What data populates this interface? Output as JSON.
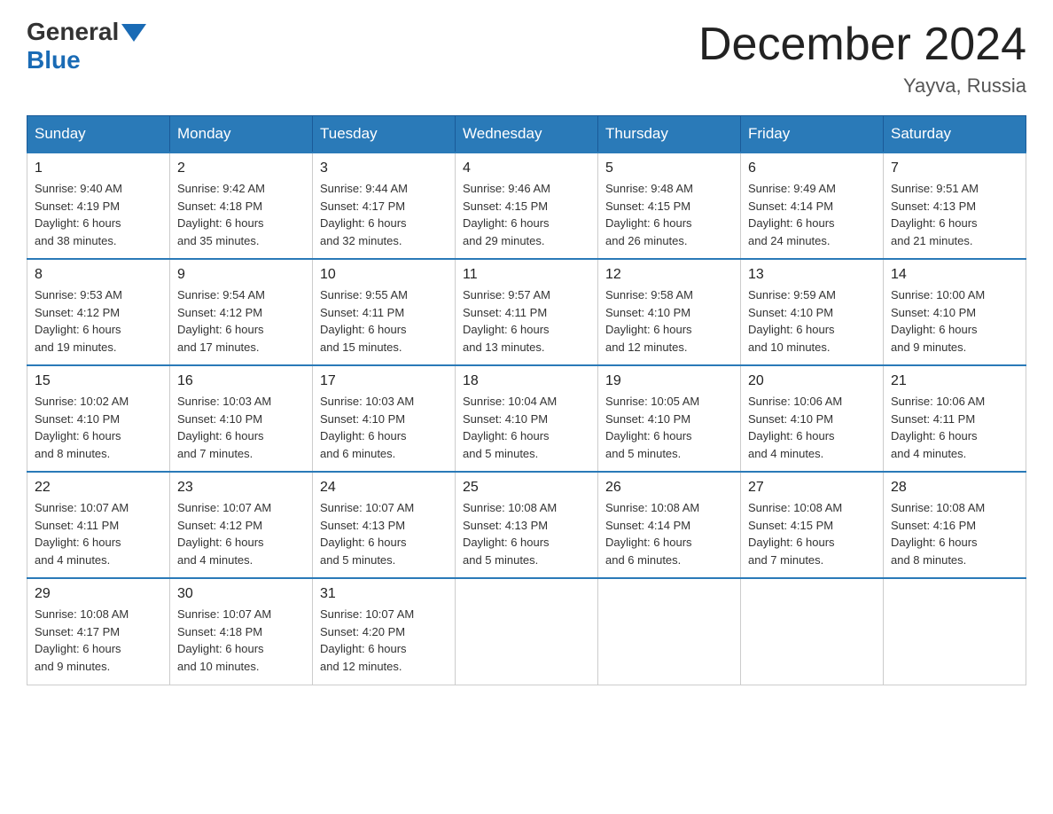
{
  "logo": {
    "text_general": "General",
    "text_blue": "Blue"
  },
  "title": "December 2024",
  "location": "Yayva, Russia",
  "days_of_week": [
    "Sunday",
    "Monday",
    "Tuesday",
    "Wednesday",
    "Thursday",
    "Friday",
    "Saturday"
  ],
  "weeks": [
    [
      {
        "day": "1",
        "info": "Sunrise: 9:40 AM\nSunset: 4:19 PM\nDaylight: 6 hours\nand 38 minutes."
      },
      {
        "day": "2",
        "info": "Sunrise: 9:42 AM\nSunset: 4:18 PM\nDaylight: 6 hours\nand 35 minutes."
      },
      {
        "day": "3",
        "info": "Sunrise: 9:44 AM\nSunset: 4:17 PM\nDaylight: 6 hours\nand 32 minutes."
      },
      {
        "day": "4",
        "info": "Sunrise: 9:46 AM\nSunset: 4:15 PM\nDaylight: 6 hours\nand 29 minutes."
      },
      {
        "day": "5",
        "info": "Sunrise: 9:48 AM\nSunset: 4:15 PM\nDaylight: 6 hours\nand 26 minutes."
      },
      {
        "day": "6",
        "info": "Sunrise: 9:49 AM\nSunset: 4:14 PM\nDaylight: 6 hours\nand 24 minutes."
      },
      {
        "day": "7",
        "info": "Sunrise: 9:51 AM\nSunset: 4:13 PM\nDaylight: 6 hours\nand 21 minutes."
      }
    ],
    [
      {
        "day": "8",
        "info": "Sunrise: 9:53 AM\nSunset: 4:12 PM\nDaylight: 6 hours\nand 19 minutes."
      },
      {
        "day": "9",
        "info": "Sunrise: 9:54 AM\nSunset: 4:12 PM\nDaylight: 6 hours\nand 17 minutes."
      },
      {
        "day": "10",
        "info": "Sunrise: 9:55 AM\nSunset: 4:11 PM\nDaylight: 6 hours\nand 15 minutes."
      },
      {
        "day": "11",
        "info": "Sunrise: 9:57 AM\nSunset: 4:11 PM\nDaylight: 6 hours\nand 13 minutes."
      },
      {
        "day": "12",
        "info": "Sunrise: 9:58 AM\nSunset: 4:10 PM\nDaylight: 6 hours\nand 12 minutes."
      },
      {
        "day": "13",
        "info": "Sunrise: 9:59 AM\nSunset: 4:10 PM\nDaylight: 6 hours\nand 10 minutes."
      },
      {
        "day": "14",
        "info": "Sunrise: 10:00 AM\nSunset: 4:10 PM\nDaylight: 6 hours\nand 9 minutes."
      }
    ],
    [
      {
        "day": "15",
        "info": "Sunrise: 10:02 AM\nSunset: 4:10 PM\nDaylight: 6 hours\nand 8 minutes."
      },
      {
        "day": "16",
        "info": "Sunrise: 10:03 AM\nSunset: 4:10 PM\nDaylight: 6 hours\nand 7 minutes."
      },
      {
        "day": "17",
        "info": "Sunrise: 10:03 AM\nSunset: 4:10 PM\nDaylight: 6 hours\nand 6 minutes."
      },
      {
        "day": "18",
        "info": "Sunrise: 10:04 AM\nSunset: 4:10 PM\nDaylight: 6 hours\nand 5 minutes."
      },
      {
        "day": "19",
        "info": "Sunrise: 10:05 AM\nSunset: 4:10 PM\nDaylight: 6 hours\nand 5 minutes."
      },
      {
        "day": "20",
        "info": "Sunrise: 10:06 AM\nSunset: 4:10 PM\nDaylight: 6 hours\nand 4 minutes."
      },
      {
        "day": "21",
        "info": "Sunrise: 10:06 AM\nSunset: 4:11 PM\nDaylight: 6 hours\nand 4 minutes."
      }
    ],
    [
      {
        "day": "22",
        "info": "Sunrise: 10:07 AM\nSunset: 4:11 PM\nDaylight: 6 hours\nand 4 minutes."
      },
      {
        "day": "23",
        "info": "Sunrise: 10:07 AM\nSunset: 4:12 PM\nDaylight: 6 hours\nand 4 minutes."
      },
      {
        "day": "24",
        "info": "Sunrise: 10:07 AM\nSunset: 4:13 PM\nDaylight: 6 hours\nand 5 minutes."
      },
      {
        "day": "25",
        "info": "Sunrise: 10:08 AM\nSunset: 4:13 PM\nDaylight: 6 hours\nand 5 minutes."
      },
      {
        "day": "26",
        "info": "Sunrise: 10:08 AM\nSunset: 4:14 PM\nDaylight: 6 hours\nand 6 minutes."
      },
      {
        "day": "27",
        "info": "Sunrise: 10:08 AM\nSunset: 4:15 PM\nDaylight: 6 hours\nand 7 minutes."
      },
      {
        "day": "28",
        "info": "Sunrise: 10:08 AM\nSunset: 4:16 PM\nDaylight: 6 hours\nand 8 minutes."
      }
    ],
    [
      {
        "day": "29",
        "info": "Sunrise: 10:08 AM\nSunset: 4:17 PM\nDaylight: 6 hours\nand 9 minutes."
      },
      {
        "day": "30",
        "info": "Sunrise: 10:07 AM\nSunset: 4:18 PM\nDaylight: 6 hours\nand 10 minutes."
      },
      {
        "day": "31",
        "info": "Sunrise: 10:07 AM\nSunset: 4:20 PM\nDaylight: 6 hours\nand 12 minutes."
      },
      null,
      null,
      null,
      null
    ]
  ]
}
